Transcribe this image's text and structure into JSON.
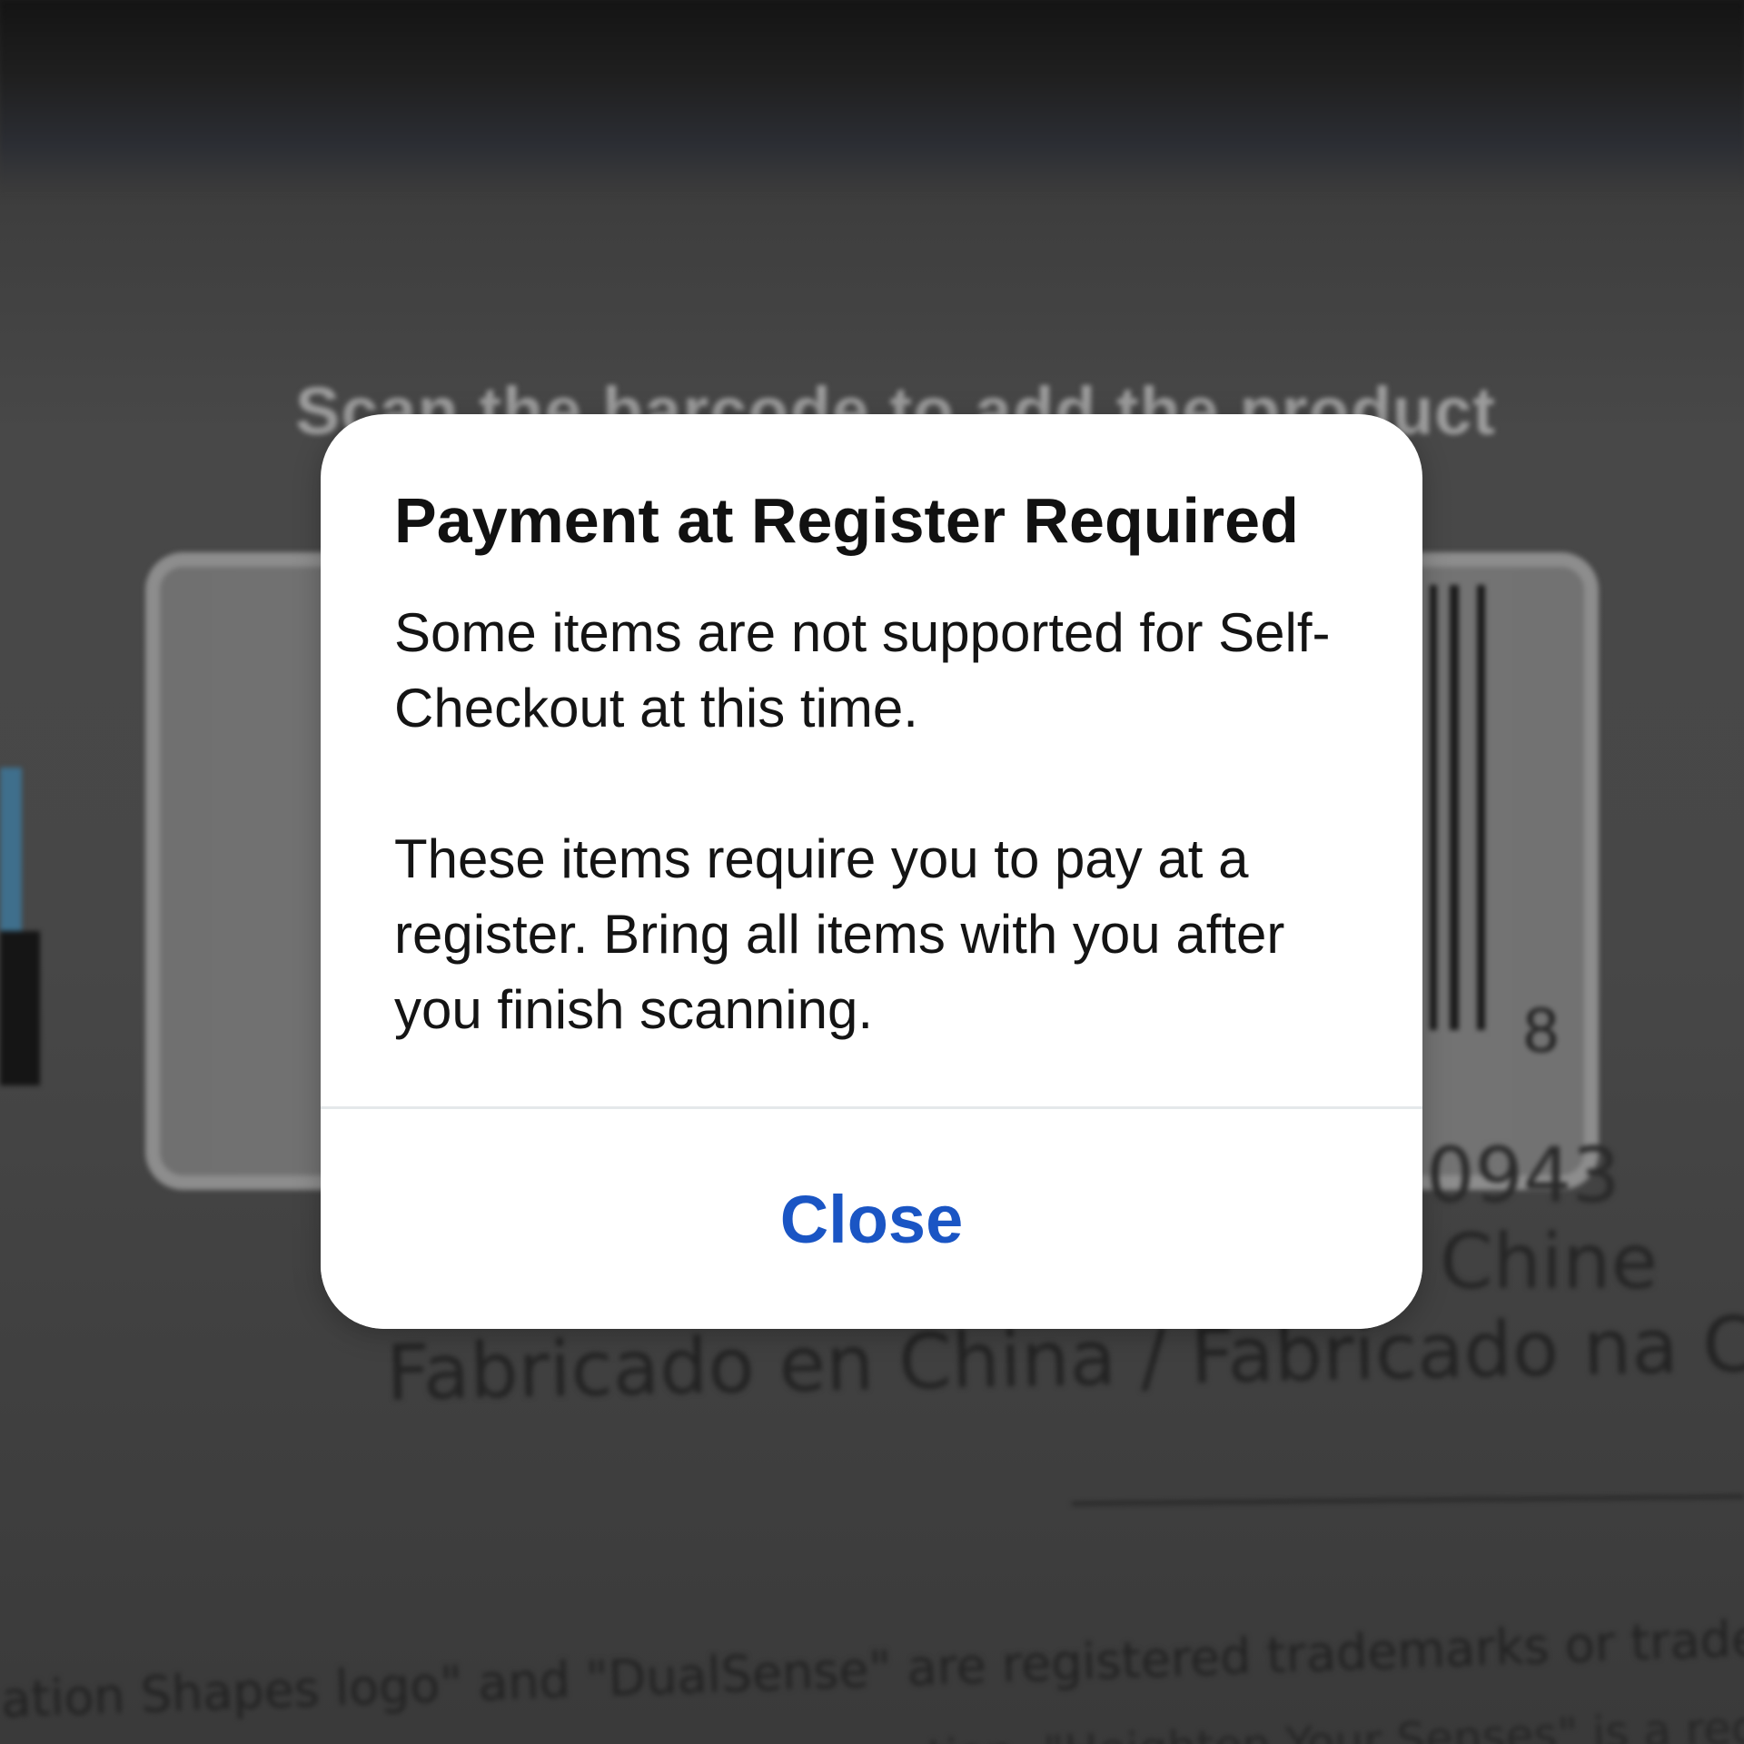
{
  "background": {
    "scan_hint": "Scan the barcode to add the product",
    "barcode_digit": "8",
    "partial_number": "0943",
    "partial_made_in": "Chine",
    "made_in_line": "Fabricado en China / Fabricado na China",
    "legal_line_1": "ation Shapes logo\" and \"DualSense\" are registered trademarks or trademarks of",
    "legal_line_2": "tion. \"Heighten Your Senses\" is a regist"
  },
  "dialog": {
    "title": "Payment at Register Required",
    "message_1": "Some items are not supported for Self-Checkout at this time.",
    "message_2": "These items require you to pay at a register. Bring all items with you after you finish scanning.",
    "close_label": "Close"
  },
  "colors": {
    "accent": "#1a55c4",
    "dialog_bg": "#ffffff",
    "overlay": "#474747"
  }
}
